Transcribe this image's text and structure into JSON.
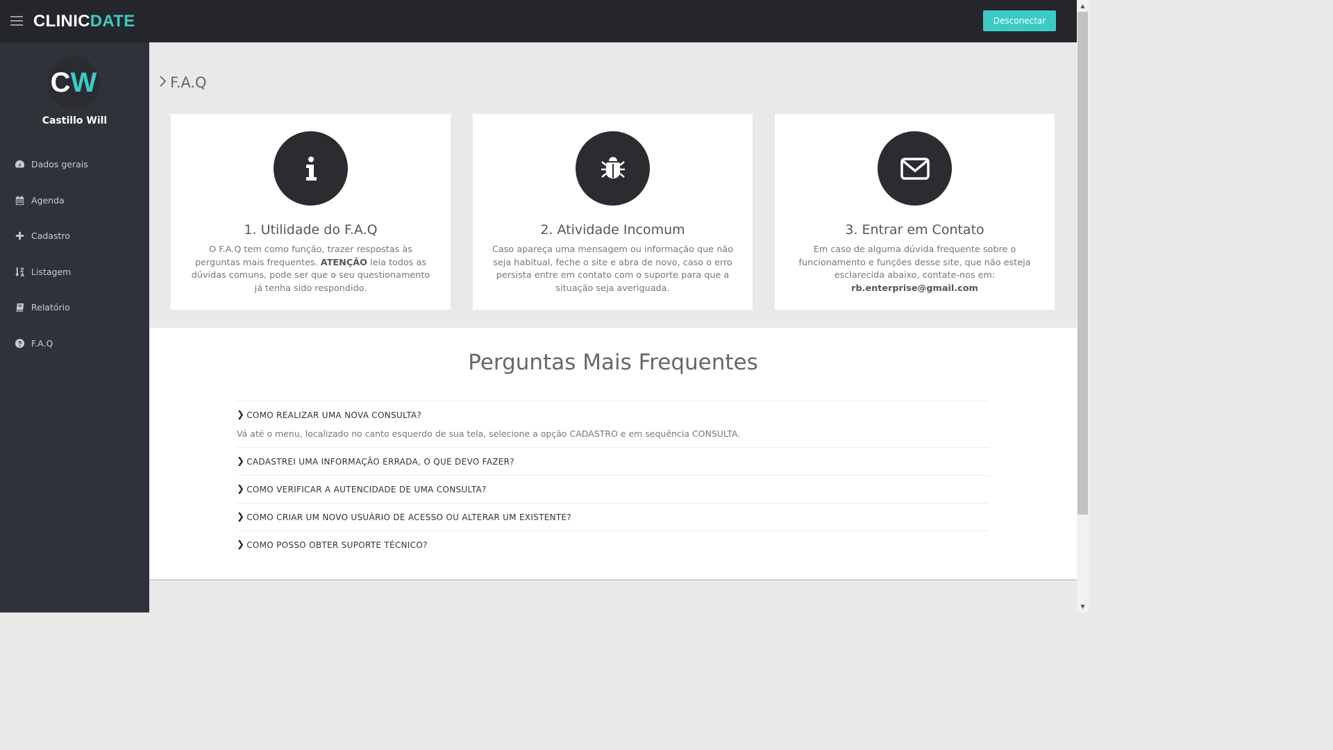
{
  "header": {
    "brand_part1": "CLINIC",
    "brand_part2": "DATE",
    "logout_label": "Desconectar",
    "accent_color": "#3ccbc4"
  },
  "sidebar": {
    "avatar_initial1": "C",
    "avatar_initial2": "W",
    "user_name": "Castillo Will",
    "items": [
      {
        "label": "Dados gerais",
        "icon": "dashboard-icon"
      },
      {
        "label": "Agenda",
        "icon": "calendar-icon"
      },
      {
        "label": "Cadastro",
        "icon": "plus-icon"
      },
      {
        "label": "Listagem",
        "icon": "sort-alpha-icon"
      },
      {
        "label": "Relatório",
        "icon": "book-icon"
      },
      {
        "label": "F.A.Q",
        "icon": "question-circle-icon"
      }
    ]
  },
  "main": {
    "breadcrumb": "F.A.Q",
    "cards": [
      {
        "icon": "info-icon",
        "title": "1. Utilidade do F.A.Q",
        "text_before": "O F.A.Q tem como função, trazer respostas às perguntas mais frequentes. ",
        "text_bold": "ATENÇÃO",
        "text_after": " leia todos as dúvidas comuns, pode ser que o seu questionamento já tenha sido respondido."
      },
      {
        "icon": "bug-icon",
        "title": "2. Atividade Incomum",
        "text_before": "Caso apareça uma mensagem ou informação que não seja habitual, feche o site e abra de novo, caso o erro persista entre em contato com o suporte para que a situação seja averiguada.",
        "text_bold": "",
        "text_after": ""
      },
      {
        "icon": "envelope-icon",
        "title": "3. Entrar em Contato",
        "text_before": "Em caso de alguma dúvida frequente sobre o funcionamento e funções desse site, que não esteja esclarecida abaixo, contate-nos em: ",
        "text_bold": "rb.enterprise@gmail.com",
        "text_after": ""
      }
    ],
    "faq_title": "Perguntas Mais Frequentes",
    "faq": [
      {
        "question": "COMO REALIZAR UMA NOVA CONSULTA?",
        "answer": "Vá até o menu, localizado no canto esquerdo de sua tela, selecione a opção CADASTRO e em sequência CONSULTA."
      },
      {
        "question": "CADASTREI UMA INFORMAÇÃO ERRADA, O QUE DEVO FAZER?",
        "answer": ""
      },
      {
        "question": "COMO VERIFICAR A AUTENCIDADE DE UMA CONSULTA?",
        "answer": ""
      },
      {
        "question": "COMO CRIAR UM NOVO USUÁRIO DE ACESSO OU ALTERAR UM EXISTENTE?",
        "answer": ""
      },
      {
        "question": "COMO POSSO OBTER SUPORTE TÉCNICO?",
        "answer": ""
      }
    ]
  }
}
